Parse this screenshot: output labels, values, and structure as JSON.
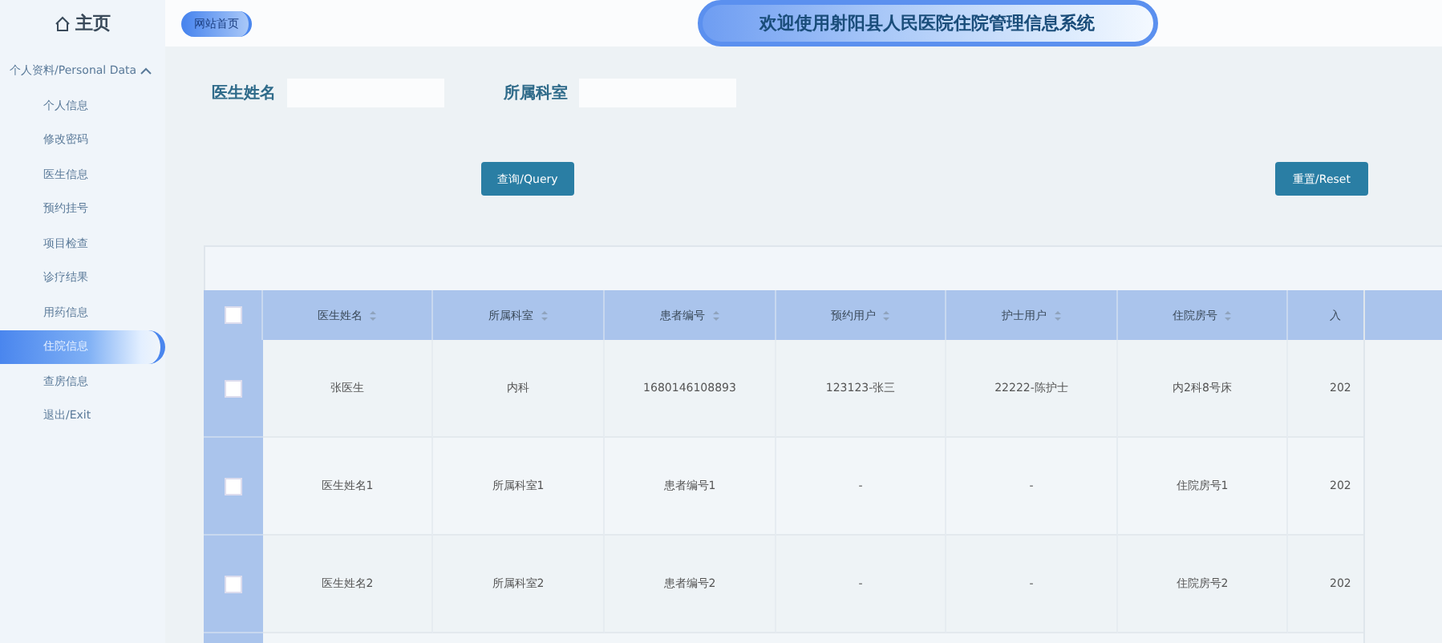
{
  "sidebar": {
    "home": "主页",
    "group": {
      "label": "个人资料/Personal Data",
      "expanded": true,
      "items": [
        {
          "label": "个人信息",
          "selected": false
        },
        {
          "label": "修改密码",
          "selected": false
        },
        {
          "label": "医生信息",
          "selected": false
        },
        {
          "label": "预约挂号",
          "selected": false
        },
        {
          "label": "项目检查",
          "selected": false
        },
        {
          "label": "诊疗结果",
          "selected": false
        },
        {
          "label": "用药信息",
          "selected": false
        },
        {
          "label": "住院信息",
          "selected": true
        },
        {
          "label": "查房信息",
          "selected": false
        },
        {
          "label": "退出/Exit",
          "selected": false
        }
      ]
    }
  },
  "header": {
    "home_link": "网站首页",
    "title": "欢迎使用射阳县人民医院住院管理信息系统"
  },
  "search": {
    "fields": [
      {
        "label": "医生姓名"
      },
      {
        "label": "所属科室"
      }
    ],
    "buttons": [
      "查询/Query",
      "重置/Reset"
    ]
  },
  "table": {
    "header_checked": false,
    "columns": [
      "医生姓名",
      "所属科室",
      "患者编号",
      "预约用户",
      "护士用户",
      "住院房号",
      "入"
    ],
    "rows": [
      {
        "checked": false,
        "cells": [
          "张医生",
          "内科",
          "1680146108893",
          "123123-张三",
          "22222-陈护士",
          "内2科8号床",
          "202"
        ]
      },
      {
        "checked": false,
        "cells": [
          "医生姓名1",
          "所属科室1",
          "患者编号1",
          "-",
          "-",
          "住院房号1",
          "202"
        ]
      },
      {
        "checked": false,
        "cells": [
          "医生姓名2",
          "所属科室2",
          "患者编号2",
          "-",
          "-",
          "住院房号2",
          "202"
        ]
      }
    ]
  }
}
